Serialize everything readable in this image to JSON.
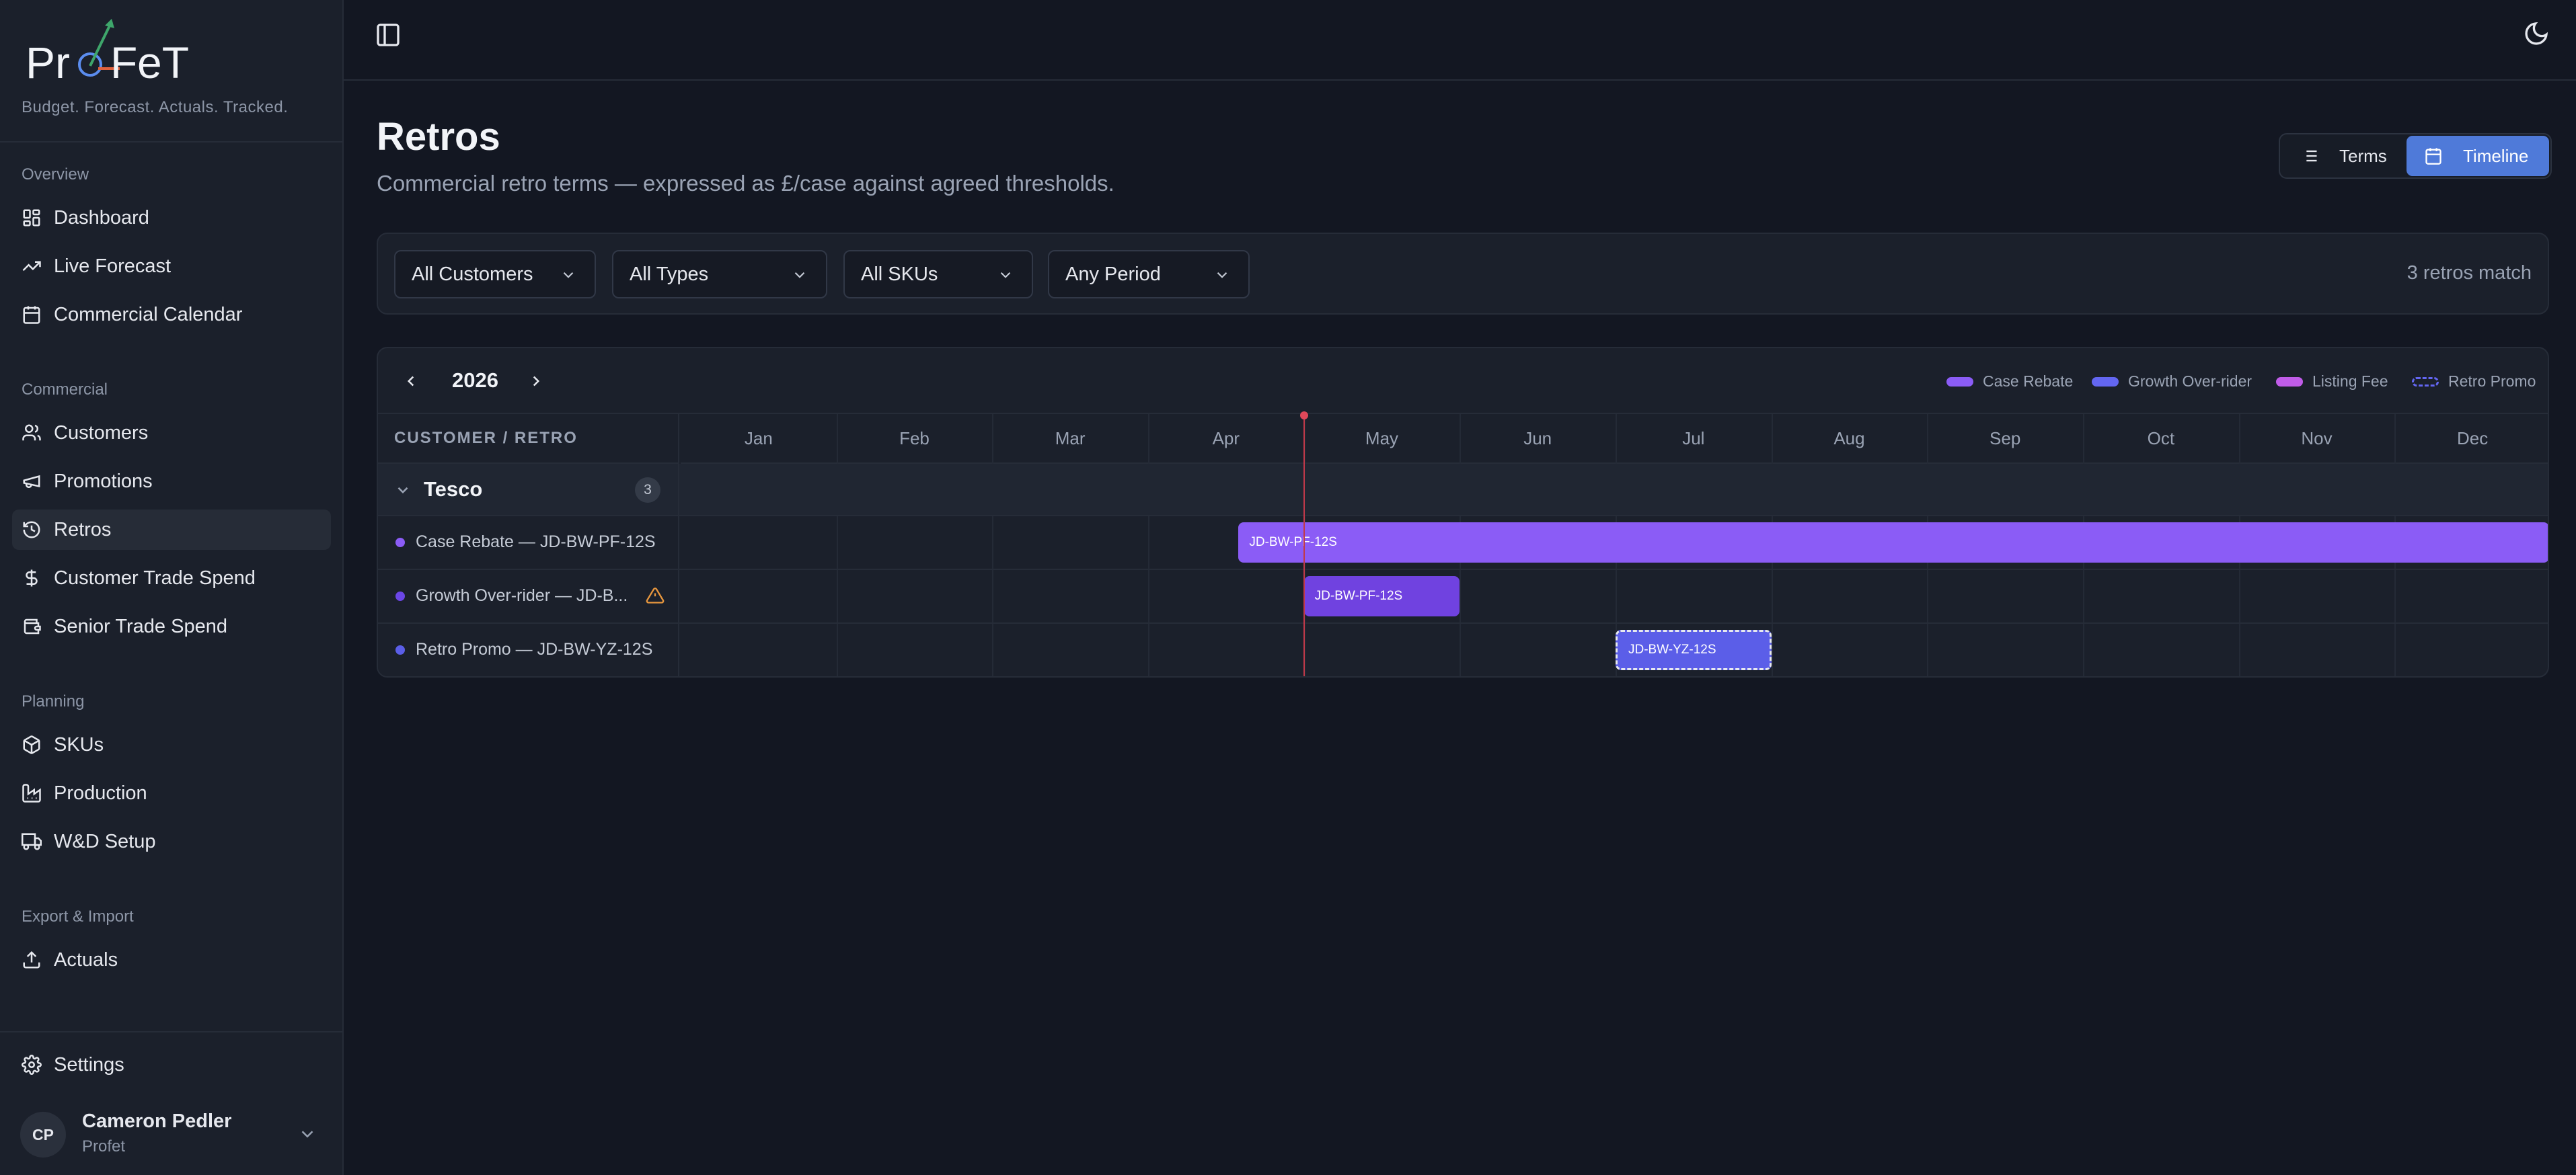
{
  "app": {
    "logo_text": "ProFeT",
    "tagline": "Budget. Forecast. Actuals. Tracked."
  },
  "sidebar": {
    "sections": [
      {
        "title": "Overview",
        "items": [
          {
            "label": "Dashboard",
            "icon": "dashboard-icon"
          },
          {
            "label": "Live Forecast",
            "icon": "trending-up-icon"
          },
          {
            "label": "Commercial Calendar",
            "icon": "calendar-icon"
          }
        ]
      },
      {
        "title": "Commercial",
        "items": [
          {
            "label": "Customers",
            "icon": "users-icon"
          },
          {
            "label": "Promotions",
            "icon": "megaphone-icon"
          },
          {
            "label": "Retros",
            "icon": "history-icon",
            "active": true
          },
          {
            "label": "Customer Trade Spend",
            "icon": "dollar-icon"
          },
          {
            "label": "Senior Trade Spend",
            "icon": "wallet-icon"
          }
        ]
      },
      {
        "title": "Planning",
        "items": [
          {
            "label": "SKUs",
            "icon": "package-icon"
          },
          {
            "label": "Production",
            "icon": "factory-icon"
          },
          {
            "label": "W&D Setup",
            "icon": "truck-icon"
          }
        ]
      },
      {
        "title": "Export & Import",
        "items": [
          {
            "label": "Actuals",
            "icon": "upload-icon"
          }
        ]
      }
    ],
    "settings_label": "Settings",
    "user": {
      "initials": "CP",
      "name": "Cameron Pedler",
      "org": "Profet"
    }
  },
  "page": {
    "title": "Retros",
    "subtitle": "Commercial retro terms — expressed as £/case against agreed thresholds.",
    "view_toggle": {
      "terms_label": "Terms",
      "timeline_label": "Timeline",
      "active": "Timeline"
    }
  },
  "filters": {
    "customer": "All Customers",
    "type": "All Types",
    "sku": "All SKUs",
    "period": "Any Period",
    "match_count": "3 retros match"
  },
  "timeline": {
    "year": "2026",
    "left_header": "CUSTOMER / RETRO",
    "months": [
      "Jan",
      "Feb",
      "Mar",
      "Apr",
      "May",
      "Jun",
      "Jul",
      "Aug",
      "Sep",
      "Oct",
      "Nov",
      "Dec"
    ],
    "legend": [
      {
        "label": "Case Rebate",
        "color": "#8b5cf6"
      },
      {
        "label": "Growth Over-rider",
        "color": "#6366f1"
      },
      {
        "label": "Listing Fee",
        "color": "#c05ce8"
      },
      {
        "label": "Retro Promo",
        "color": "#6366f1",
        "dashed": true
      }
    ],
    "today_month_position": 4.0,
    "groups": [
      {
        "name": "Tesco",
        "count": "3",
        "rows": [
          {
            "label": "Case Rebate — JD-BW-PF-12S",
            "bar_label": "JD-BW-PF-12S",
            "color": "#8b5cf6",
            "start_month": 3.58,
            "end_month": 12.0,
            "warning": false,
            "dashed": false
          },
          {
            "label": "Growth Over-rider — JD-B...",
            "bar_label": "JD-BW-PF-12S",
            "color": "#7042e0",
            "start_month": 4.0,
            "end_month": 5.0,
            "warning": true,
            "dashed": false
          },
          {
            "label": "Retro Promo — JD-BW-YZ-12S",
            "bar_label": "JD-BW-YZ-12S",
            "color": "#5b5ee8",
            "start_month": 6.0,
            "end_month": 7.0,
            "warning": false,
            "dashed": true
          }
        ]
      }
    ]
  }
}
